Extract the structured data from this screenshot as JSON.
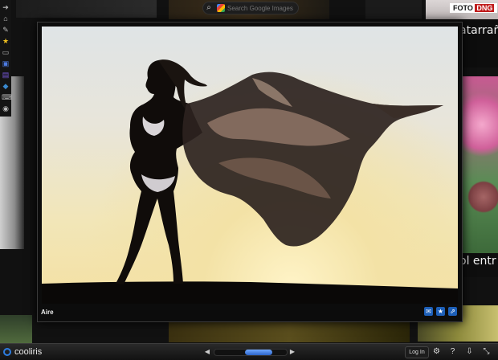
{
  "search": {
    "placeholder": "Search Google Images"
  },
  "background": {
    "caption_right_top": "atarrañ",
    "caption_right_bottom": "ol entr",
    "foto_badge_text": "FOTO",
    "foto_badge_red": "DNG"
  },
  "left_toolbar": {
    "icons": [
      "arrow-icon",
      "home-icon",
      "pencil-icon",
      "star-icon",
      "monitor-icon",
      "tv-icon",
      "film-icon",
      "puzzle-icon",
      "keyboard-icon",
      "gamepad-icon"
    ]
  },
  "viewer": {
    "caption": "Aire",
    "actions": [
      {
        "icon": "mail-icon",
        "glyph": "✉"
      },
      {
        "icon": "star-icon",
        "glyph": "★"
      },
      {
        "icon": "share-icon",
        "glyph": "⇗"
      }
    ]
  },
  "bottombar": {
    "logo_text": "cooliris",
    "login_label": "Log In",
    "settings_glyph": "⚙",
    "help_glyph": "?",
    "export_glyph": "⇩",
    "fullscreen_glyph": "⤡",
    "scroll_left": "◀",
    "scroll_right": "▶"
  },
  "colors": {
    "accent": "#2d7de0",
    "bar": "#121212"
  }
}
